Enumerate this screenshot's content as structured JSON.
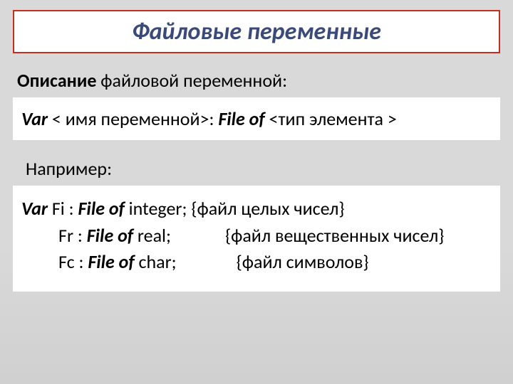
{
  "title": "Файловые переменные",
  "subhead": {
    "bold": "Описание",
    "rest": " файловой переменной:"
  },
  "syntax": {
    "var": "Var",
    "name_part": "  < имя переменной>: ",
    "fileof": "File of",
    "type_part": "  <тип элемента >"
  },
  "example_label": "Например:",
  "ex": {
    "var": "Var",
    "r1": {
      "decl": "  Fi :  ",
      "kw": "File of",
      "type": "  integer;",
      "comment": "{файл целых чисел}"
    },
    "r2": {
      "decl": "Fr : ",
      "kw": "File of",
      "type": "  real;",
      "comment": "{файл вещественных чисел}"
    },
    "r3": {
      "decl": "Fc : ",
      "kw": "File of",
      "type": "  char;",
      "comment": "{файл символов}"
    }
  }
}
